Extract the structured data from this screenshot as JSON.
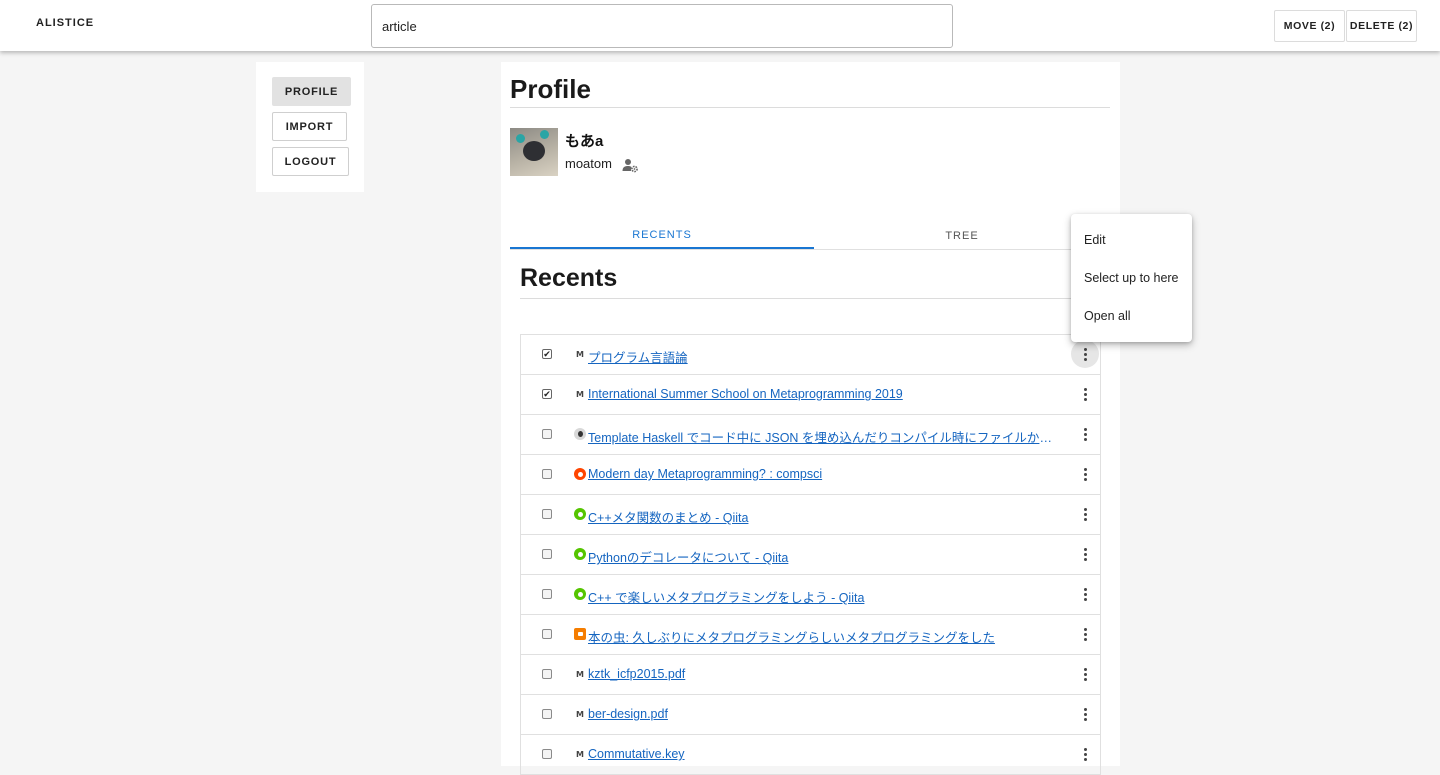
{
  "app": {
    "brand": "ALISTICE"
  },
  "search": {
    "value": "article"
  },
  "toolbar": {
    "move_label": "MOVE (2)",
    "delete_label": "DELETE (2)"
  },
  "nav": {
    "profile": "PROFILE",
    "import": "IMPORT",
    "logout": "LOGOUT"
  },
  "profile": {
    "title": "Profile",
    "display_name": "もあa",
    "username": "moatom"
  },
  "tabs": {
    "recents": "RECENTS",
    "tree": "TREE",
    "active": "RECENTS"
  },
  "recents": {
    "title": "Recents",
    "items": [
      {
        "title": " プログラム言語論",
        "checked": true,
        "favicon": "markdown-icon"
      },
      {
        "title": " International Summer School on Metaprogramming 2019",
        "checked": true,
        "favicon": "markdown-icon"
      },
      {
        "title": " Template Haskell でコード中に JSON を埋め込んだりコンパイル時にファイルから…",
        "checked": false,
        "favicon": "github-icon"
      },
      {
        "title": " Modern day Metaprogramming? : compsci",
        "checked": false,
        "favicon": "reddit-icon"
      },
      {
        "title": " C++メタ関数のまとめ - Qiita",
        "checked": false,
        "favicon": "qiita-icon"
      },
      {
        "title": " Pythonのデコレータについて - Qiita",
        "checked": false,
        "favicon": "qiita-icon"
      },
      {
        "title": " C++ で楽しいメタプログラミングをしよう - Qiita",
        "checked": false,
        "favicon": "qiita-icon"
      },
      {
        "title": " 本の虫: 久しぶりにメタプログラミングらしいメタプログラミングをした",
        "checked": false,
        "favicon": "blogger-icon"
      },
      {
        "title": " kztk_icfp2015.pdf",
        "checked": false,
        "favicon": "markdown-icon"
      },
      {
        "title": " ber-design.pdf",
        "checked": false,
        "favicon": "markdown-icon"
      },
      {
        "title": " Commutative.key",
        "checked": false,
        "favicon": "markdown-icon"
      }
    ]
  },
  "context_menu": {
    "items": [
      {
        "label": "Edit"
      },
      {
        "label": "Select up to here"
      },
      {
        "label": "Open all"
      }
    ]
  },
  "colors": {
    "accent": "#1976d2",
    "link": "#1565c0",
    "qiita": "#55c500",
    "reddit": "#ff4500",
    "blogger": "#f57d00"
  }
}
